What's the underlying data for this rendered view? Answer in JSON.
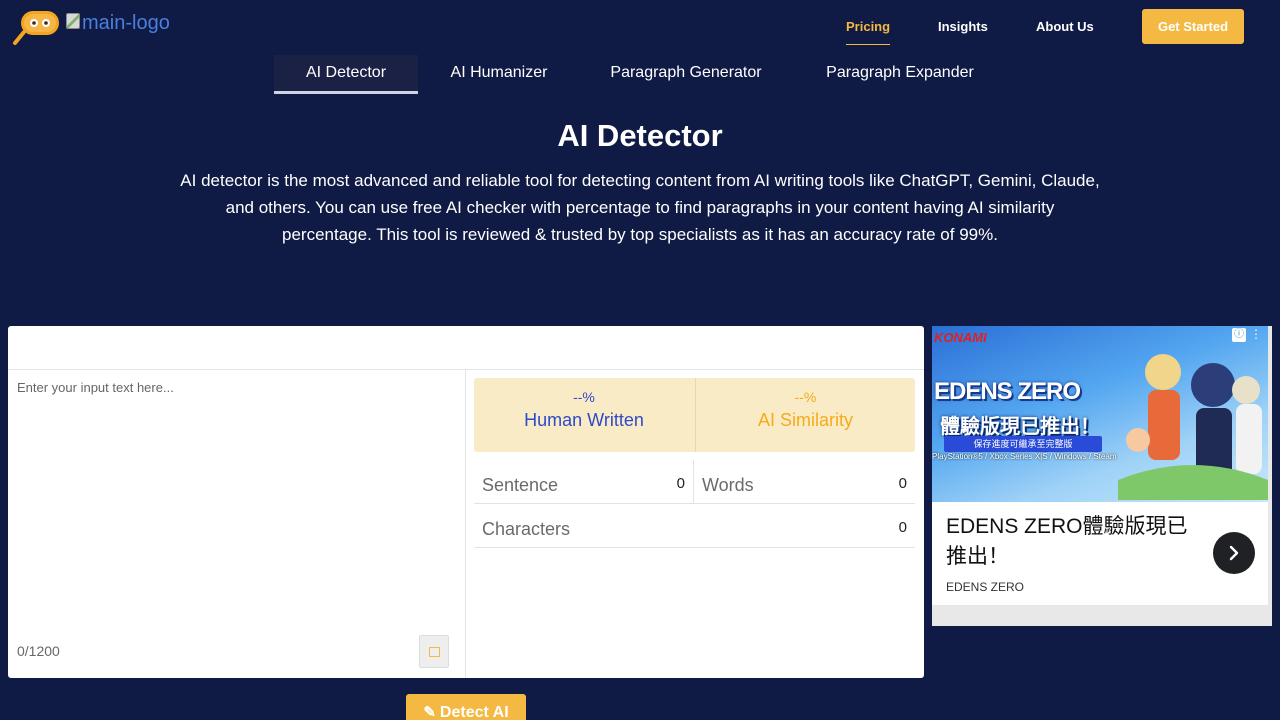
{
  "header": {
    "logo_alt": "main-logo",
    "nav": [
      {
        "label": "Pricing",
        "active": true
      },
      {
        "label": "Insights",
        "active": false
      },
      {
        "label": "About Us",
        "active": false
      }
    ],
    "cta_label": "Get Started"
  },
  "tabs": [
    {
      "label": "AI Detector",
      "active": true
    },
    {
      "label": "AI Humanizer",
      "active": false
    },
    {
      "label": "Paragraph Generator",
      "active": false
    },
    {
      "label": "Paragraph Expander",
      "active": false
    }
  ],
  "hero": {
    "title": "AI Detector",
    "description": "AI detector is the most advanced and reliable tool for detecting content from AI writing tools like ChatGPT, Gemini, Claude, and others. You can use free AI checker with percentage to find paragraphs in your content having AI similarity percentage. This tool is reviewed & trusted by top specialists as it has an accuracy rate of 99%."
  },
  "tool": {
    "input_placeholder": "Enter your input text here...",
    "char_count": "0/1200",
    "human": {
      "percent": "--%",
      "label": "Human Written"
    },
    "ai": {
      "percent": "--%",
      "label": "AI Similarity"
    },
    "stats": {
      "sentence_label": "Sentence",
      "sentence_value": "0",
      "words_label": "Words",
      "words_value": "0",
      "characters_label": "Characters",
      "characters_value": "0"
    },
    "detect_label": "Detect AI"
  },
  "ad": {
    "brand": "KONAMI",
    "logo_text": "EDENS ZERO",
    "headline": "體驗版現已推出！",
    "strip_text": "保存進度可繼承至完整版",
    "platforms": "PlayStation®5 / Xbox Series X|S / Windows / Steam",
    "title": "EDENS ZERO體驗版現已推出！",
    "source": "EDENS ZERO"
  },
  "colors": {
    "background": "#0f1a45",
    "accent": "#f4b942",
    "human": "#2f4ac8",
    "ai": "#f4ab1c"
  }
}
